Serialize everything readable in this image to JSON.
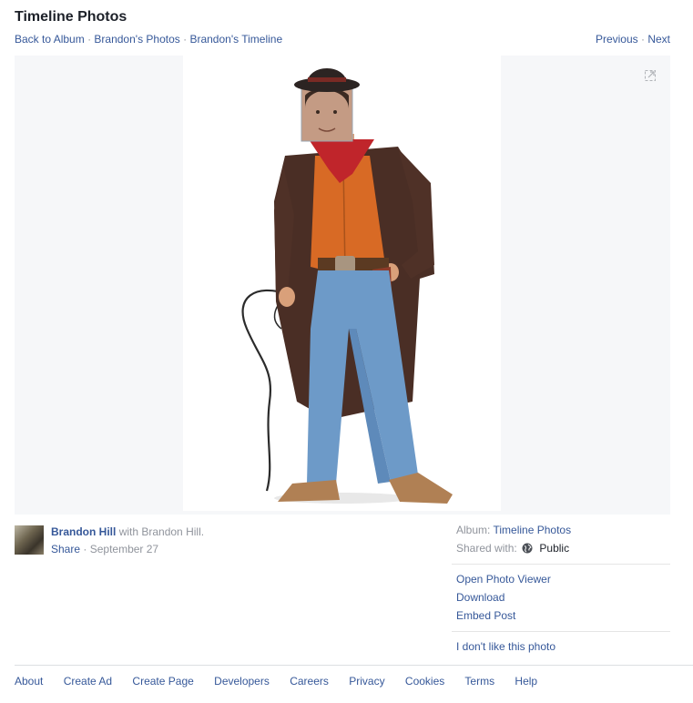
{
  "header": {
    "title": "Timeline Photos",
    "breadcrumbs": [
      "Back to Album",
      "Brandon's Photos",
      "Brandon's Timeline"
    ],
    "breadcrumb_separator": "·",
    "previous_label": "Previous",
    "next_label": "Next"
  },
  "photo": {
    "alt": "Costume photo of a cowboy with a whip",
    "expand_icon": "expand-icon"
  },
  "post": {
    "author": "Brandon Hill",
    "with_text": "with Brandon Hill.",
    "share_label": "Share",
    "separator": "·",
    "date": "September 27"
  },
  "side": {
    "album_label": "Album:",
    "album_value": "Timeline Photos",
    "shared_label": "Shared with:",
    "shared_value": "Public",
    "actions": [
      "Open Photo Viewer",
      "Download",
      "Embed Post"
    ],
    "report": "I don't like this photo"
  },
  "footer": {
    "links": [
      "About",
      "Create Ad",
      "Create Page",
      "Developers",
      "Careers",
      "Privacy",
      "Cookies",
      "Terms",
      "Help"
    ]
  },
  "colors": {
    "link": "#365899",
    "muted": "#90949c",
    "stage_bg": "#f6f7f9"
  }
}
